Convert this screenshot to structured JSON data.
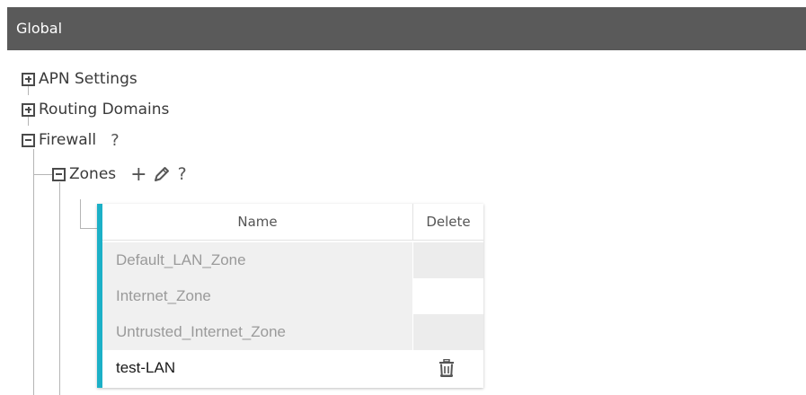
{
  "header": {
    "title": "Global"
  },
  "tree": {
    "apn_settings": "APN Settings",
    "routing_domains": "Routing Domains",
    "firewall": "Firewall",
    "firewall_help": "?",
    "zones": "Zones",
    "zones_add": "+",
    "zones_help": "?"
  },
  "table": {
    "columns": [
      "Name",
      "Delete"
    ],
    "rows": [
      {
        "name": "Default_LAN_Zone"
      },
      {
        "name": "Internet_Zone"
      },
      {
        "name": "Untrusted_Internet_Zone"
      },
      {
        "name": "test-LAN"
      }
    ]
  },
  "icons": {
    "expand": "plus-box-icon",
    "collapse": "minus-box-icon",
    "edit": "pencil-icon",
    "delete": "trash-icon"
  },
  "colors": {
    "header_bg": "#5a5a5a",
    "accent": "#1cb0c7"
  }
}
